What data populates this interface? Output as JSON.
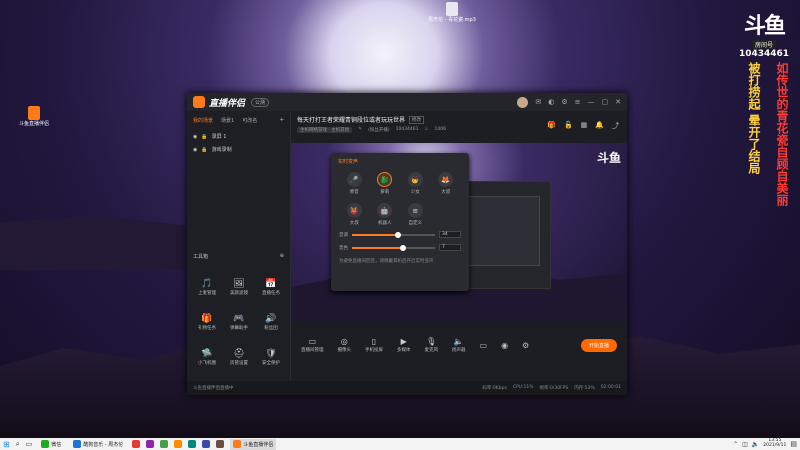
{
  "desktop": {
    "icons": [
      {
        "label": "斗鱼直播伴侣"
      },
      {
        "label": "周杰伦 - 青花瓷.mp3"
      }
    ]
  },
  "brand": {
    "logo": "斗鱼",
    "room_label": "房间号",
    "room_number": "10434461"
  },
  "overlay": {
    "yellow_text": "被打捞起 晕开了结局",
    "red_text": "如传世的青花瓷自顾自美丽"
  },
  "app": {
    "name": "直播伴侣",
    "version_badge": "公测",
    "scene_tabs": [
      "我的场景",
      "场景1",
      "可改名"
    ],
    "sources": [
      {
        "label": "录屏 1"
      },
      {
        "label": "游戏录制"
      }
    ],
    "tools_header": "工具箱",
    "tools": [
      {
        "icon": "🎵",
        "label": "上麦管理"
      },
      {
        "icon": "🖼",
        "label": "美颜滤镜"
      },
      {
        "icon": "📅",
        "label": "直播任务"
      },
      {
        "icon": "🎁",
        "label": "礼物任务"
      },
      {
        "icon": "🎮",
        "label": "弹幕助手"
      },
      {
        "icon": "🔊",
        "label": "粉丝团"
      },
      {
        "icon": "🛸",
        "label": "小飞机圈"
      },
      {
        "icon": "⛑",
        "label": "房管设置"
      },
      {
        "icon": "🛡",
        "label": "安全保护"
      }
    ],
    "room": {
      "title": "每天打打王者荣耀青铜段位或者玩玩世界",
      "tag": "修改",
      "category": "主机网络游戏 · 主机其他",
      "edit": "✎",
      "room_no_label": "(粉丝开播)",
      "room_no": "10434461",
      "viewers": "1406"
    },
    "voice_panel": {
      "title": "实时变声",
      "voices": [
        {
          "icon": "🎤",
          "label": "原音"
        },
        {
          "icon": "🐉",
          "label": "萝莉"
        },
        {
          "icon": "👦",
          "label": "少女"
        },
        {
          "icon": "🦊",
          "label": "大叔"
        },
        {
          "icon": "👹",
          "label": "大叔"
        },
        {
          "icon": "🤖",
          "label": "机器人"
        },
        {
          "icon": "≡",
          "label": "自定义"
        }
      ],
      "slider1_label": "音调",
      "slider1_value": "34",
      "slider1_fill": 0.56,
      "slider2_label": "音色",
      "slider2_value": "7",
      "slider2_fill": 0.62,
      "tip": "为避免直播间回音，请佩戴耳机后开启实时变声"
    },
    "controls": [
      {
        "icon": "▭",
        "label": "直播间管理"
      },
      {
        "icon": "◎",
        "label": "摄像头"
      },
      {
        "icon": "▯",
        "label": "手机投屏"
      },
      {
        "icon": "▶",
        "label": "多媒体"
      },
      {
        "icon": "🎙",
        "label": "麦克风"
      },
      {
        "icon": "🔈",
        "label": "扬声器"
      }
    ],
    "go_live": "开始直播",
    "status": {
      "left": "斗鱼直播伴侣直播中",
      "stats": [
        "码率:0Kbps",
        "CPU:11%",
        "帧率:0/30FPS",
        "内存:53%"
      ],
      "time": "02:00:01"
    }
  },
  "taskbar": {
    "apps": [
      {
        "label": "微信",
        "color": "#1aad19"
      },
      {
        "label": "酷狗音乐 - 周杰伦",
        "color": "#1976d2"
      },
      {
        "label": "斗鱼直播伴侣",
        "color": "#ff7a1a"
      }
    ],
    "clock_time": "13:55",
    "clock_date": "2021/9/11"
  }
}
